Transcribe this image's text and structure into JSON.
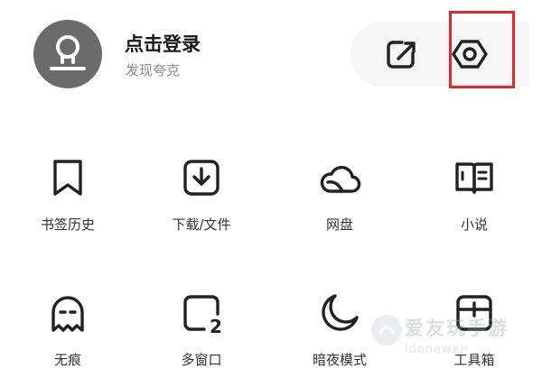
{
  "header": {
    "login_title": "点击登录",
    "login_subtitle": "发现夸克",
    "actions": [
      {
        "name": "share",
        "icon": "share-arrow-icon"
      },
      {
        "name": "settings",
        "icon": "hexagon-settings-icon"
      }
    ],
    "highlight_color": "#e8262a"
  },
  "grid": {
    "items": [
      {
        "label": "书签历史",
        "icon": "bookmark-icon"
      },
      {
        "label": "下载/文件",
        "icon": "download-icon"
      },
      {
        "label": "网盘",
        "icon": "cloud-icon"
      },
      {
        "label": "小说",
        "icon": "book-icon"
      },
      {
        "label": "无痕",
        "icon": "ghost-icon"
      },
      {
        "label": "多窗口",
        "icon": "multi-window-icon",
        "badge": "2"
      },
      {
        "label": "暗夜模式",
        "icon": "moon-icon"
      },
      {
        "label": "工具箱",
        "icon": "toolbox-icon"
      }
    ]
  },
  "watermark": {
    "title": "爱友玩手游",
    "url": "idonewan"
  }
}
